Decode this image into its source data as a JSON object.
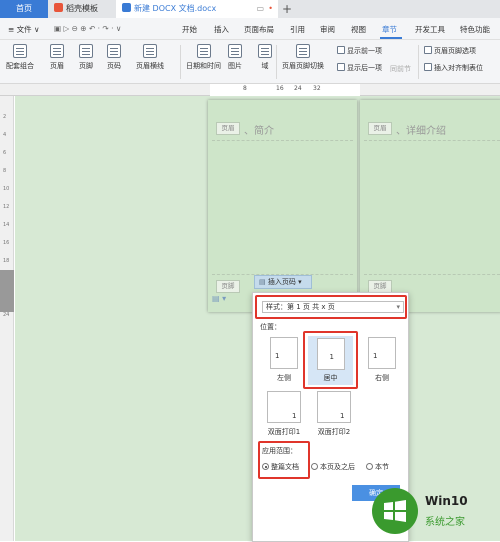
{
  "tabs": {
    "home": "首页",
    "templates": "稻壳模板",
    "document": "新建 DOCX 文档.docx",
    "add": "+"
  },
  "menubar": {
    "file": "≡ 文件 ∨",
    "items": [
      "开始",
      "插入",
      "页面布局",
      "引用",
      "审阅",
      "视图",
      "章节",
      "开发工具",
      "特色功能"
    ]
  },
  "ribbon": {
    "buttons": [
      "配套组合",
      "页眉",
      "页脚",
      "页码",
      "页眉横线",
      "日期和时间",
      "图片",
      "域",
      "页眉页脚切换"
    ],
    "show_prev": "显示前一项",
    "show_next": "显示后一项",
    "same_prev": "同前节",
    "hf_options": "页眉页脚选项",
    "insert_align_tab": "插入对齐制表位"
  },
  "ruler": {
    "numbers": [
      "8",
      "16",
      "24",
      "32"
    ]
  },
  "left_ruler": [
    "2",
    "4",
    "6",
    "8",
    "10",
    "12",
    "14",
    "16",
    "18",
    "20",
    "22",
    "24"
  ],
  "pages": {
    "left": {
      "header_tag": "页眉",
      "text": "、简介",
      "footer_tag": "页脚"
    },
    "right": {
      "header_tag": "页眉",
      "text": "、详细介绍",
      "footer_tag": "页脚"
    }
  },
  "insert_page_number": {
    "button_label": "插入页码 ▾",
    "style_label": "样式：",
    "style_value": "第 1 页 共 x 页",
    "position_label": "位置：",
    "positions": [
      {
        "label": "左侧",
        "num": "1"
      },
      {
        "label": "居中",
        "num": "1"
      },
      {
        "label": "右侧",
        "num": "1"
      },
      {
        "label": "双面打印1",
        "num": "1"
      },
      {
        "label": "双面打印2",
        "num": "1"
      }
    ],
    "scope_label": "应用范围：",
    "scope_options": [
      "整篇文档",
      "本页及之后",
      "本节"
    ],
    "selected_scope": "整篇文档",
    "confirm": "确定"
  },
  "watermark": {
    "title": "Win10",
    "subtitle": "系统之家"
  },
  "colors": {
    "accent": "#3a7bd5",
    "highlight_box": "#e0352b",
    "canvas": "#d7e9d4"
  }
}
